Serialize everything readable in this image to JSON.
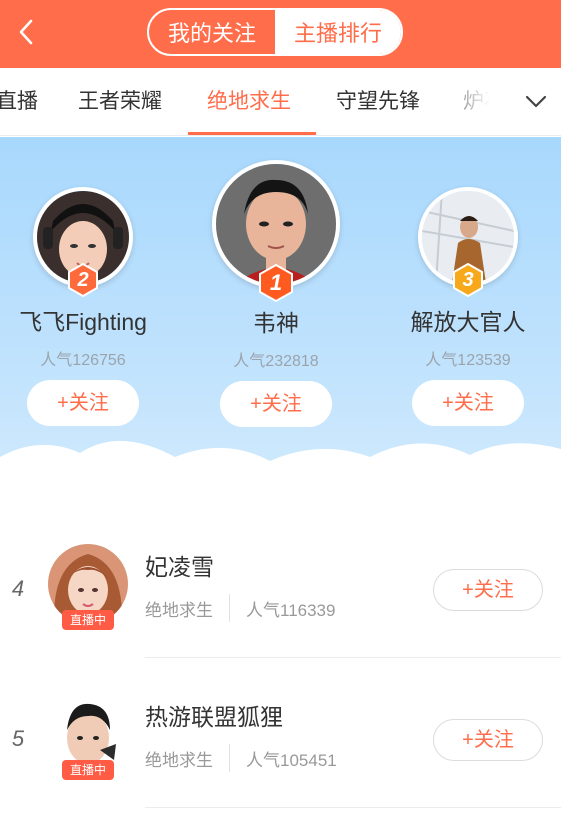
{
  "header": {
    "segments": [
      {
        "label": "我的关注",
        "active": false
      },
      {
        "label": "主播排行",
        "active": true
      }
    ],
    "colors": {
      "brand": "#ff6d4a"
    }
  },
  "tabs": {
    "items": [
      {
        "label": "直播",
        "active": false
      },
      {
        "label": "王者荣耀",
        "active": false
      },
      {
        "label": "绝地求生",
        "active": true
      },
      {
        "label": "守望先锋",
        "active": false
      },
      {
        "label": "炉石",
        "active": false
      }
    ],
    "more_icon": "chevron-down-icon"
  },
  "podium": {
    "top": [
      {
        "rank": "1",
        "name": "韦神",
        "popularity": "人气232818",
        "follow_label": "+关注",
        "badge_color": "#ff5a1f"
      },
      {
        "rank": "2",
        "name": "飞飞Fighting",
        "popularity": "人气126756",
        "follow_label": "+关注",
        "badge_color": "#ff6a3d"
      },
      {
        "rank": "3",
        "name": "解放大官人",
        "popularity": "人气123539",
        "follow_label": "+关注",
        "badge_color": "#f7a81b"
      }
    ]
  },
  "list": {
    "rows": [
      {
        "rank": "4",
        "name": "妃凌雪",
        "category": "绝地求生",
        "popularity": "人气116339",
        "live_badge": "直播中",
        "follow_label": "+关注"
      },
      {
        "rank": "5",
        "name": "热游联盟狐狸",
        "category": "绝地求生",
        "popularity": "人气105451",
        "live_badge": "直播中",
        "follow_label": "+关注"
      }
    ]
  }
}
